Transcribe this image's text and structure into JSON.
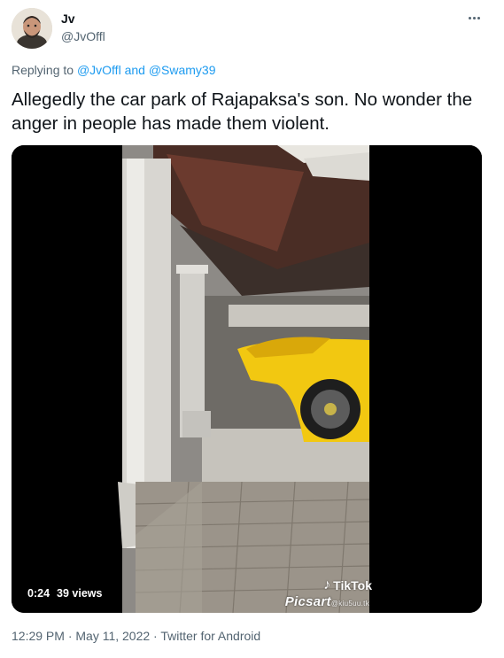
{
  "tweet": {
    "display_name": "Jv",
    "handle": "@JvOffl",
    "replying_prefix": "Replying to",
    "replying_mention_1": "@JvOffl",
    "replying_and": "and",
    "replying_mention_2": "@Swamy39",
    "text": "Allegedly the car park of Rajapaksa's son. No wonder the anger in people has made them violent.",
    "timestamp": "12:29 PM · May 11, 2022 · Twitter for Android"
  },
  "video": {
    "duration": "0:24",
    "views": "39 views",
    "tiktok_label": "TikTok",
    "picsart_label": "Picsart",
    "watermark_user": "@kiu5uu.tk"
  },
  "icons": {
    "more": "more-horizontal-icon",
    "tiktok": "tiktok-note-icon"
  },
  "colors": {
    "link": "#1d9bf0",
    "secondary_text": "#536471",
    "car": "#f2c811"
  }
}
